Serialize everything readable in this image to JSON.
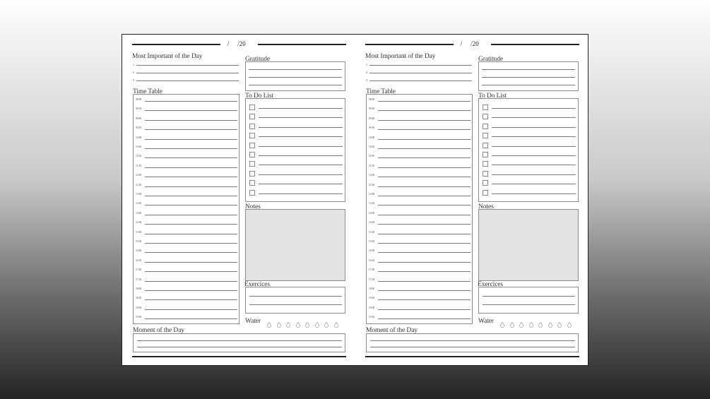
{
  "pages": [
    {
      "id": "left",
      "date": {
        "slash": "/",
        "year": "/20"
      },
      "most_important": {
        "title": "Most Important of the Day",
        "numbers": [
          "1",
          "2",
          "3"
        ]
      },
      "gratitude": {
        "title": "Gratitude"
      },
      "time_table": {
        "title": "Time Table",
        "times": [
          "08:00",
          "08:30",
          "09:00",
          "09:30",
          "10:00",
          "10:30",
          "11:00",
          "11:30",
          "12:00",
          "12:30",
          "13:00",
          "13:30",
          "14:00",
          "14:30",
          "15:00",
          "15:30",
          "16:00",
          "16:30",
          "17:00",
          "17:30",
          "18:00",
          "18:30",
          "19:00",
          "19:30"
        ]
      },
      "todo": {
        "title": "To Do List",
        "item_count": 10
      },
      "notes": {
        "title": "Notes"
      },
      "exercises": {
        "title": "Exercices"
      },
      "water": {
        "title": "Water",
        "drop_count": 8,
        "drop_icon": "water-drop-icon"
      },
      "moment": {
        "title": "Moment of the Day"
      }
    },
    {
      "id": "right",
      "date": {
        "slash": "/",
        "year": "/20"
      },
      "most_important": {
        "title": "Most Important of the Day",
        "numbers": [
          "1",
          "2",
          "3"
        ]
      },
      "gratitude": {
        "title": "Gratitude"
      },
      "time_table": {
        "title": "Time Table",
        "times": [
          "08:00",
          "08:30",
          "09:00",
          "09:30",
          "10:00",
          "10:30",
          "11:00",
          "11:30",
          "12:00",
          "12:30",
          "13:00",
          "13:30",
          "14:00",
          "14:30",
          "15:00",
          "15:30",
          "16:00",
          "16:30",
          "17:00",
          "17:30",
          "18:00",
          "18:30",
          "19:00",
          "19:30"
        ]
      },
      "todo": {
        "title": "To Do List",
        "item_count": 10
      },
      "notes": {
        "title": "Notes"
      },
      "exercises": {
        "title": "Exercices"
      },
      "water": {
        "title": "Water",
        "drop_count": 8,
        "drop_icon": "water-drop-icon"
      },
      "moment": {
        "title": "Moment of the Day"
      }
    }
  ],
  "colors": {
    "line": "#7a7a7a",
    "heavy_line": "#222222",
    "notes_fill": "#e3e3e3"
  }
}
